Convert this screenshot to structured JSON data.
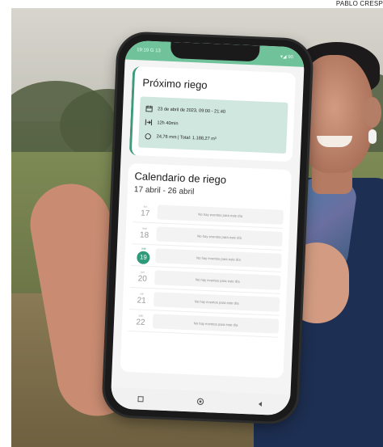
{
  "credit": "PABLO CRESP",
  "phone": {
    "status_bar": {
      "time": "19:19 G 13",
      "icons": "▾◢ 90"
    },
    "next_irrigation": {
      "title": "Próximo riego",
      "date_range": "23 de abril de 2023, 09:00 - 21:40",
      "duration": "12h 40min",
      "amount": "24,76 mm | Total: 1.188,27 m³",
      "icons": {
        "date": "calendar-icon",
        "duration": "duration-icon",
        "amount": "water-drop-icon"
      }
    },
    "calendar": {
      "title": "Calendario de riego",
      "range": "17 abril - 26 abril",
      "days": [
        {
          "weekday": "lun",
          "day": "17",
          "event": "No hay eventos para este día",
          "today": false
        },
        {
          "weekday": "mar",
          "day": "18",
          "event": "No hay eventos para este día",
          "today": false
        },
        {
          "weekday": "mié",
          "day": "19",
          "event": "No hay eventos para este día",
          "today": true
        },
        {
          "weekday": "jue",
          "day": "20",
          "event": "No hay eventos para este día",
          "today": false
        },
        {
          "weekday": "vie",
          "day": "21",
          "event": "No hay eventos para este día",
          "today": false
        },
        {
          "weekday": "sáb",
          "day": "22",
          "event": "No hay eventos para este día",
          "today": false
        }
      ]
    },
    "nav": {
      "items": [
        "recent-apps-icon",
        "home-icon",
        "back-icon"
      ]
    },
    "colors": {
      "accent": "#2f9a7a",
      "status_bar": "#6fc29a",
      "info_box": "#cfe7de"
    }
  }
}
